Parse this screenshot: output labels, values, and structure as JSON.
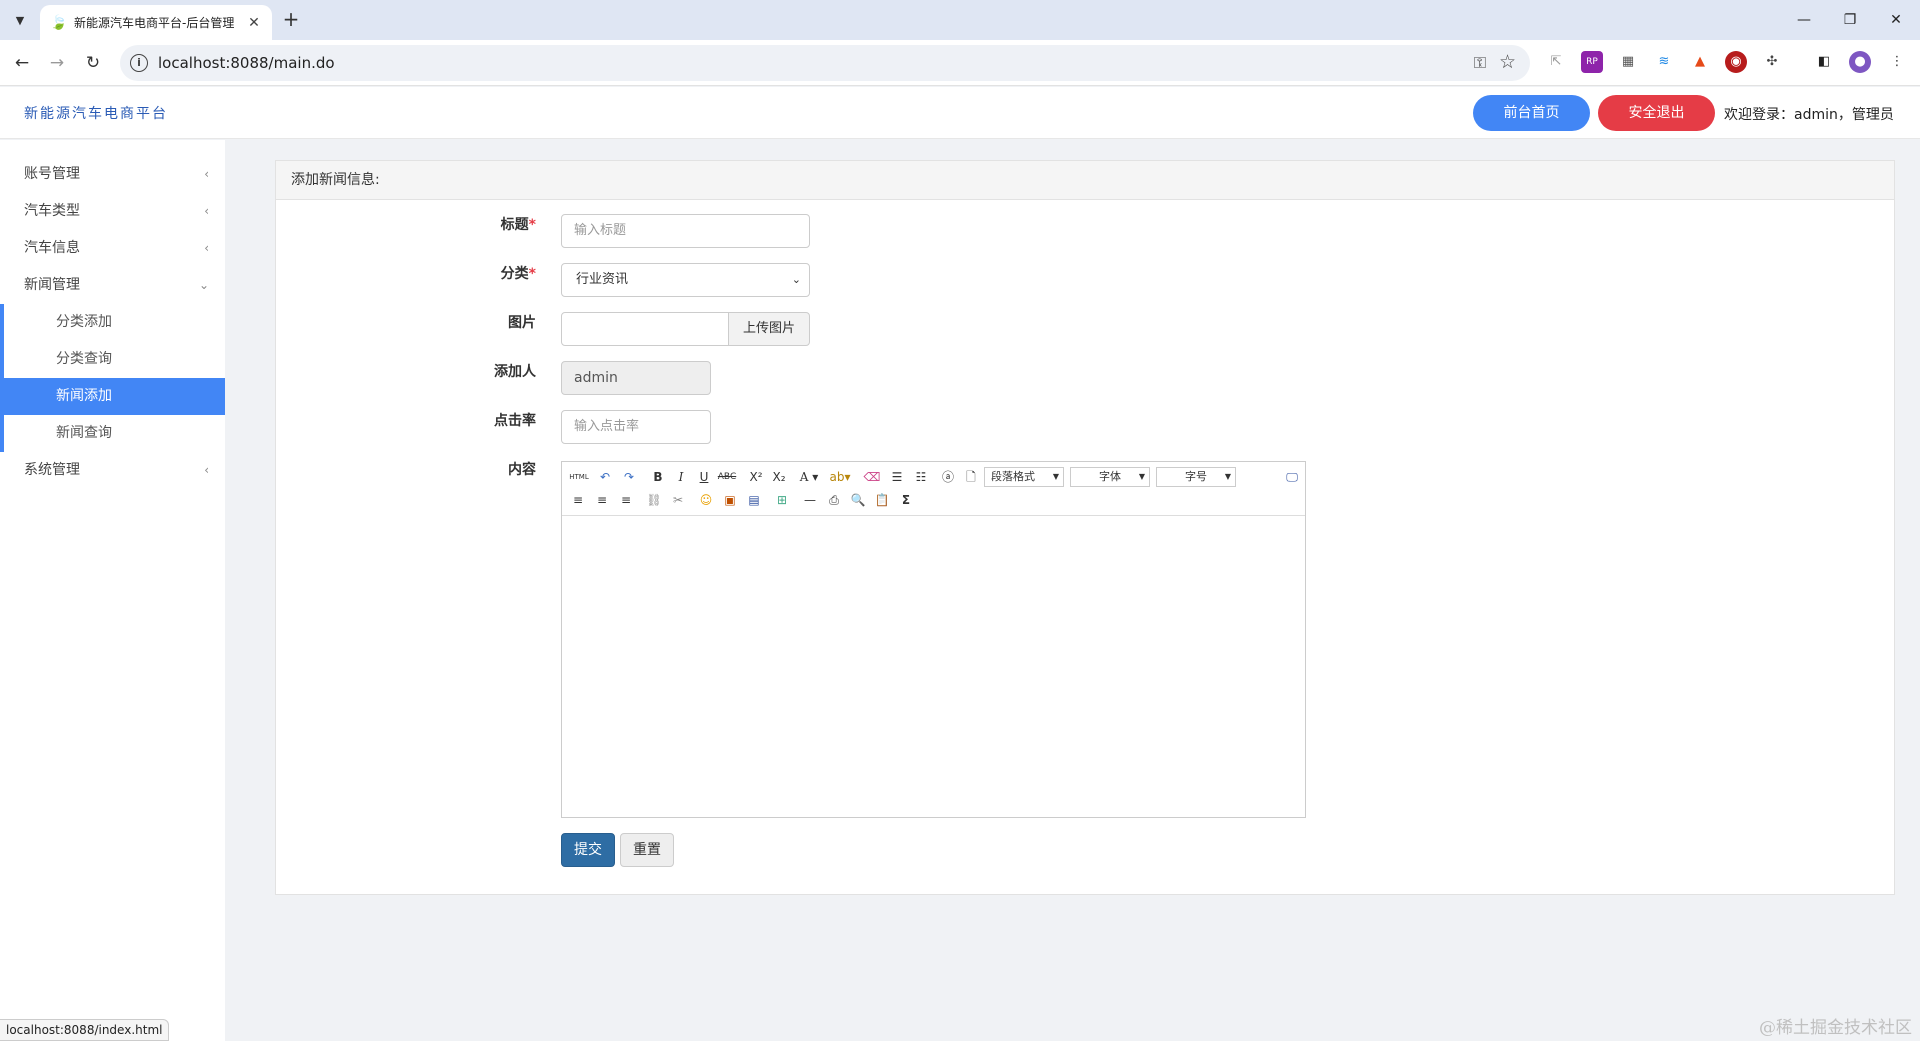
{
  "browser": {
    "tab_title": "新能源汽车电商平台-后台管理",
    "url": "localhost:8088/main.do",
    "status_url": "localhost:8088/index.html"
  },
  "header": {
    "brand": "新能源汽车电商平台",
    "home_label": "前台首页",
    "logout_label": "安全退出",
    "welcome": "欢迎登录：admin，管理员"
  },
  "sidebar": {
    "items": [
      {
        "label": "账号管理"
      },
      {
        "label": "汽车类型"
      },
      {
        "label": "汽车信息"
      },
      {
        "label": "新闻管理"
      },
      {
        "label": "系统管理"
      }
    ],
    "sub_items": [
      {
        "label": "分类添加"
      },
      {
        "label": "分类查询"
      },
      {
        "label": "新闻添加"
      },
      {
        "label": "新闻查询"
      }
    ]
  },
  "form": {
    "panel_title": "添加新闻信息:",
    "title_label": "标题",
    "title_placeholder": "输入标题",
    "category_label": "分类",
    "category_value": "行业资讯",
    "image_label": "图片",
    "upload_label": "上传图片",
    "author_label": "添加人",
    "author_value": "admin",
    "clicks_label": "点击率",
    "clicks_placeholder": "输入点击率",
    "content_label": "内容",
    "required_mark": "*",
    "submit_label": "提交",
    "reset_label": "重置"
  },
  "editor": {
    "paragraph_format": "段落格式",
    "font": "字体",
    "font_size": "字号",
    "html_label": "HTML"
  },
  "watermark": "@稀土掘金技术社区"
}
